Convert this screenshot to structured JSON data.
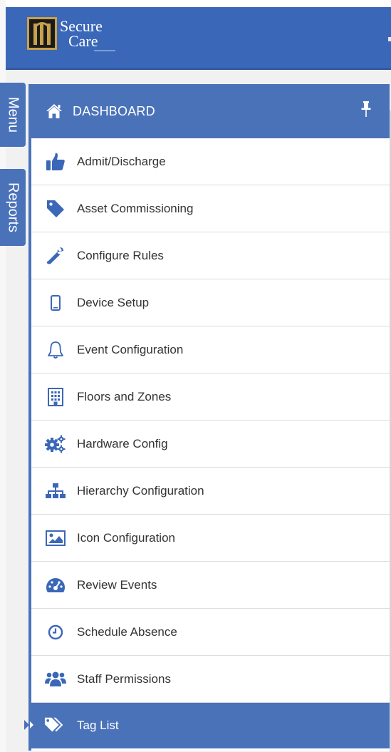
{
  "brand": {
    "line1": "Secure",
    "line2": "Care",
    "header_color": "#3b67b8",
    "accent_color": "#4a72b9"
  },
  "side_tabs": [
    {
      "label": "Menu"
    },
    {
      "label": "Reports"
    }
  ],
  "panel": {
    "title": "DASHBOARD",
    "title_icon": "home-icon",
    "pin_icon": "pin-icon"
  },
  "menu": {
    "items": [
      {
        "label": "Admit/Discharge",
        "icon": "thumbs-up-icon"
      },
      {
        "label": "Asset Commissioning",
        "icon": "tag-icon"
      },
      {
        "label": "Configure Rules",
        "icon": "wrench-icon"
      },
      {
        "label": "Device Setup",
        "icon": "mobile-icon"
      },
      {
        "label": "Event Configuration",
        "icon": "bell-icon"
      },
      {
        "label": "Floors and Zones",
        "icon": "building-icon"
      },
      {
        "label": "Hardware Config",
        "icon": "gears-icon"
      },
      {
        "label": "Hierarchy Configuration",
        "icon": "sitemap-icon"
      },
      {
        "label": "Icon Configuration",
        "icon": "image-icon"
      },
      {
        "label": "Review Events",
        "icon": "dashboard-gauge-icon"
      },
      {
        "label": "Schedule Absence",
        "icon": "clock-icon"
      },
      {
        "label": "Staff Permissions",
        "icon": "users-icon"
      },
      {
        "label": "Tag List",
        "icon": "tags-icon",
        "active": true
      }
    ]
  }
}
